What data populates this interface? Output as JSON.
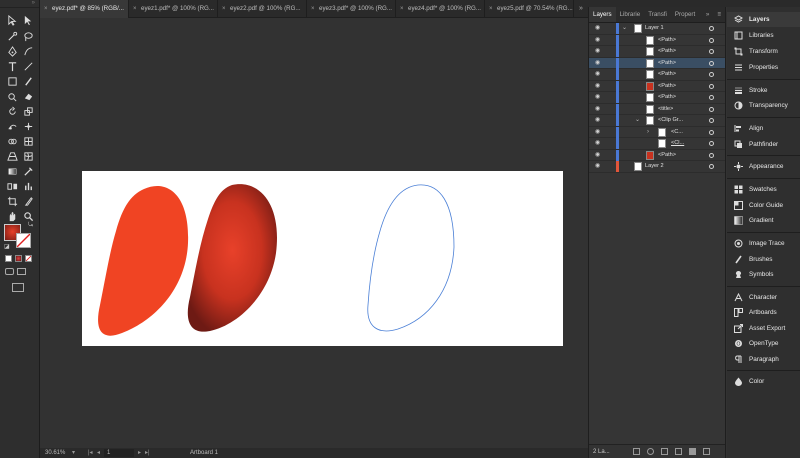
{
  "tabs": [
    {
      "label": "eyez.pdf* @ 85% (RGB/..."
    },
    {
      "label": "eyez1.pdf* @ 100% (RG..."
    },
    {
      "label": "eyez2.pdf @ 100% (RG..."
    },
    {
      "label": "eyez3.pdf* @ 100% (RG..."
    },
    {
      "label": "eyez4.pdf* @ 100% (RG..."
    },
    {
      "label": "eyez5.pdf @ 70.54% (RG..."
    }
  ],
  "tab_more": "»",
  "status": {
    "zoom": "30.61%",
    "page": "1",
    "artboard": "Artboard 1"
  },
  "layers_panel": {
    "tabs": [
      "Layers",
      "Librarie",
      "Transfi",
      "Propert"
    ],
    "rows": [
      {
        "label": "Layer 1"
      },
      {
        "label": "<Path>"
      },
      {
        "label": "<Path>"
      },
      {
        "label": "<Path>"
      },
      {
        "label": "<Path>"
      },
      {
        "label": "<Path>"
      },
      {
        "label": "<Path>"
      },
      {
        "label": "<title>"
      },
      {
        "label": "<Clip Gr..."
      },
      {
        "label": "<C..."
      },
      {
        "label": "<Cl..."
      },
      {
        "label": "<Path>"
      },
      {
        "label": "Layer 2"
      }
    ],
    "footer": "2 La..."
  },
  "dock": {
    "items": [
      {
        "label": "Layers",
        "icon": "layers-icon"
      },
      {
        "label": "Libraries",
        "icon": "libraries-icon"
      },
      {
        "label": "Transform",
        "icon": "transform-icon"
      },
      {
        "label": "Properties",
        "icon": "properties-icon"
      },
      {
        "label": "Stroke",
        "icon": "stroke-icon"
      },
      {
        "label": "Transparency",
        "icon": "transparency-icon"
      },
      {
        "label": "Align",
        "icon": "align-icon"
      },
      {
        "label": "Pathfinder",
        "icon": "pathfinder-icon"
      },
      {
        "label": "Appearance",
        "icon": "appearance-icon"
      },
      {
        "label": "Swatches",
        "icon": "swatches-icon"
      },
      {
        "label": "Color Guide",
        "icon": "color-guide-icon"
      },
      {
        "label": "Gradient",
        "icon": "gradient-icon"
      },
      {
        "label": "Image Trace",
        "icon": "image-trace-icon"
      },
      {
        "label": "Brushes",
        "icon": "brushes-icon"
      },
      {
        "label": "Symbols",
        "icon": "symbols-icon"
      },
      {
        "label": "Character",
        "icon": "character-icon"
      },
      {
        "label": "Artboards",
        "icon": "artboards-icon"
      },
      {
        "label": "Asset Export",
        "icon": "asset-export-icon"
      },
      {
        "label": "OpenType",
        "icon": "opentype-icon"
      },
      {
        "label": "Paragraph",
        "icon": "paragraph-icon"
      },
      {
        "label": "Color",
        "icon": "color-icon"
      }
    ]
  },
  "colors": {
    "shape_flat": "#f04423",
    "gradient_center": "#e8412a",
    "gradient_edge": "#6e1a14",
    "outline_stroke": "#4a7fd6",
    "selected_row": "#3a4e63"
  }
}
